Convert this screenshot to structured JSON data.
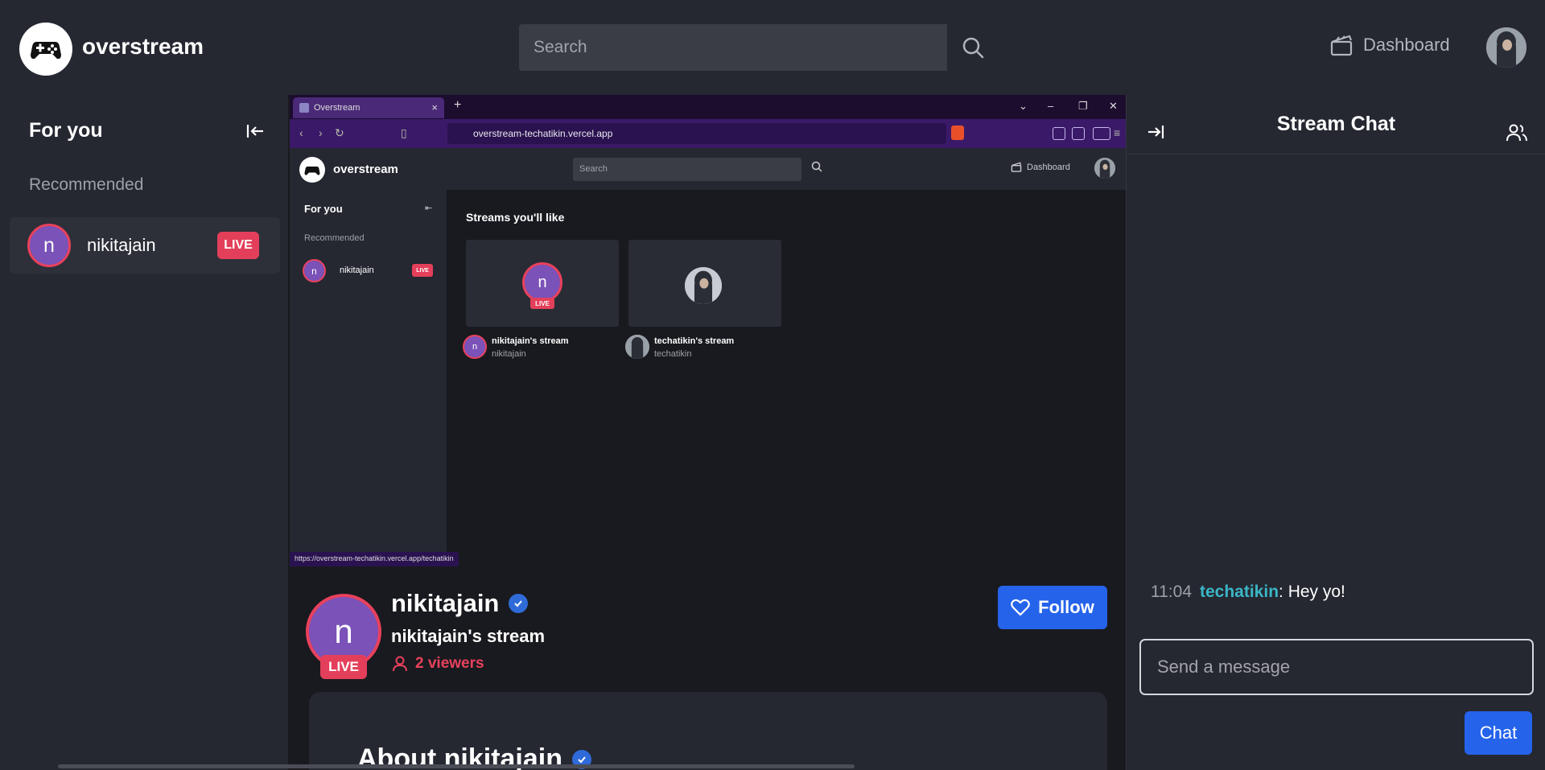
{
  "app": {
    "brand": "overstream"
  },
  "header": {
    "search_placeholder": "Search",
    "dashboard_label": "Dashboard"
  },
  "sidebar": {
    "title": "For you",
    "section_label": "Recommended",
    "items": [
      {
        "initial": "n",
        "name": "nikitajain",
        "badge": "LIVE"
      }
    ]
  },
  "browser": {
    "tab_title": "Overstream",
    "url": "overstream-techatikin.vercel.app",
    "status_url": "https://overstream-techatikin.vercel.app/techatikin",
    "page": {
      "brand": "overstream",
      "search_placeholder": "Search",
      "dashboard_label": "Dashboard",
      "sidebar_title": "For you",
      "sidebar_section": "Recommended",
      "sidebar_item": {
        "initial": "n",
        "name": "nikitajain",
        "badge": "LIVE"
      },
      "heading": "Streams you'll like",
      "cards": [
        {
          "initial": "n",
          "badge": "LIVE",
          "title": "nikitajain's stream",
          "user": "nikitajain"
        },
        {
          "title": "techatikin's stream",
          "user": "techatikin"
        }
      ]
    }
  },
  "stream": {
    "initial": "n",
    "badge": "LIVE",
    "username": "nikitajain",
    "title": "nikitajain's stream",
    "viewers": "2 viewers",
    "follow_label": "Follow",
    "about_title": "About nikitajain"
  },
  "chat": {
    "title": "Stream Chat",
    "messages": [
      {
        "time": "11:04",
        "user": "techatikin",
        "text": ": Hey yo!"
      }
    ],
    "input_placeholder": "Send a message",
    "send_label": "Chat"
  },
  "colors": {
    "live": "#e43f5a",
    "accent": "#2563eb",
    "chat_username": "#3bb6c6",
    "avatar": "#7a52b8"
  }
}
